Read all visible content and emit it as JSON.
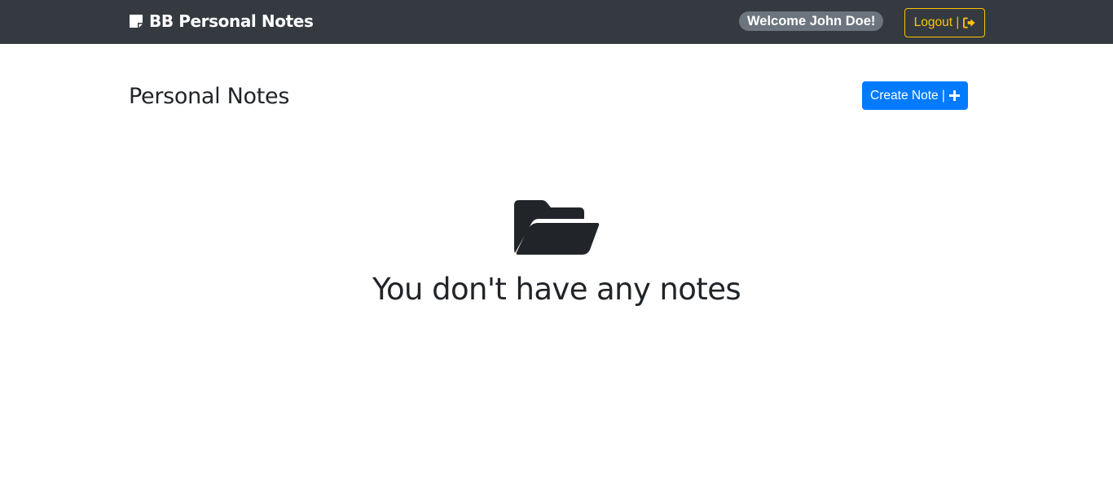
{
  "navbar": {
    "brand_title": "BB Personal Notes",
    "brand_icon": "sticky-note-icon",
    "welcome_text": "Welcome John Doe!",
    "logout_label": "Logout |",
    "logout_icon": "sign-out-icon"
  },
  "main": {
    "title": "Personal Notes",
    "create_label": "Create Note |",
    "create_icon": "plus-icon",
    "empty_icon": "folder-open-icon",
    "empty_message": "You don't have any notes"
  },
  "colors": {
    "navbar_bg": "#343a40",
    "badge_bg": "#6c757d",
    "warning": "#ffc107",
    "primary": "#007bff",
    "text_dark": "#212529"
  }
}
